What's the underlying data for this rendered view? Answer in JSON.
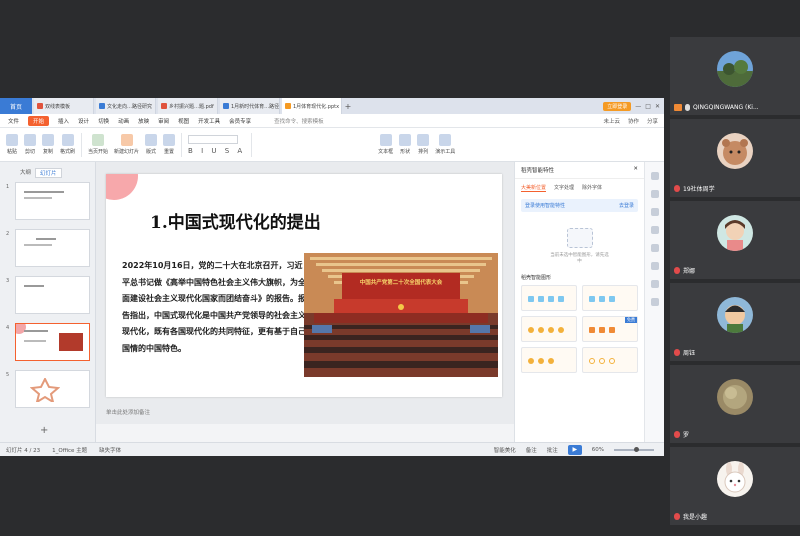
{
  "wps": {
    "home_tab": "首页",
    "doc_tabs": [
      {
        "label": "双线表模板",
        "active": false
      },
      {
        "label": "文化走向…路径研究",
        "active": false
      },
      {
        "label": "乡村振兴题…题.pdf",
        "active": false
      },
      {
        "label": "1月新时代体育…路径",
        "active": false
      },
      {
        "label": "1月体育现代化.pptx",
        "active": true
      }
    ],
    "login_button": "立即登录",
    "menu": [
      "文件",
      "开始",
      "插入",
      "设计",
      "切换",
      "动画",
      "放映",
      "审阅",
      "视图",
      "开发工具",
      "会员专享"
    ],
    "menu_active": "开始",
    "search_placeholder": "查找命令、搜索模板",
    "menu_right": [
      "未上云",
      "协作",
      "分享"
    ],
    "ribbon": [
      "粘贴",
      "剪切",
      "复制",
      "格式刷",
      "当页开始",
      "新建幻灯片",
      "版式",
      "重置",
      "文本框",
      "形状",
      "排列",
      "演示工具"
    ],
    "font_box": "",
    "panel_tabs": [
      "大纲",
      "幻灯片"
    ],
    "slide_numbers": [
      "1",
      "2",
      "3",
      "4",
      "5"
    ],
    "add_slide": "+",
    "notes_placeholder": "单击此处添加备注",
    "status_left": [
      "幻灯片 4 / 23",
      "1_Office 主题",
      "缺失字体"
    ],
    "status_right": [
      "智能美化",
      "备注",
      "批注"
    ],
    "play": "▶",
    "zoom": "60%"
  },
  "slide": {
    "title": "1.中国式现代化的提出",
    "body": "2022年10月16日，党的二十大在北京召开，习近平总书记做《高举中国特色社会主义伟大旗帜，为全面建设社会主义现代化国家而团结奋斗》的报告。报告指出，中国式现代化是中国共产党领导的社会主义现代化，既有各国现代化的共同特征，更有基于自己国情的中国特色。",
    "banner": "中国共产党第二十次全国代表大会"
  },
  "right_pane": {
    "header": "稻壳智能特性",
    "tabs": [
      "大美新位置",
      "文字处理",
      "除外字体"
    ],
    "login_hint": "登录使用智能特性",
    "login_link": "去登录",
    "empty_text": "当前未选中智能图形，请先选中",
    "section": "稻壳智能图形",
    "card_tag": "免费"
  },
  "participants": [
    {
      "name": "QINGQINGWANG (Ki...",
      "host": true
    },
    {
      "name": "19社体周学",
      "host": false
    },
    {
      "name": "郑娜",
      "host": false
    },
    {
      "name": "周钰",
      "host": false
    },
    {
      "name": "罗",
      "host": false
    },
    {
      "name": "我是小趣",
      "host": false
    }
  ]
}
